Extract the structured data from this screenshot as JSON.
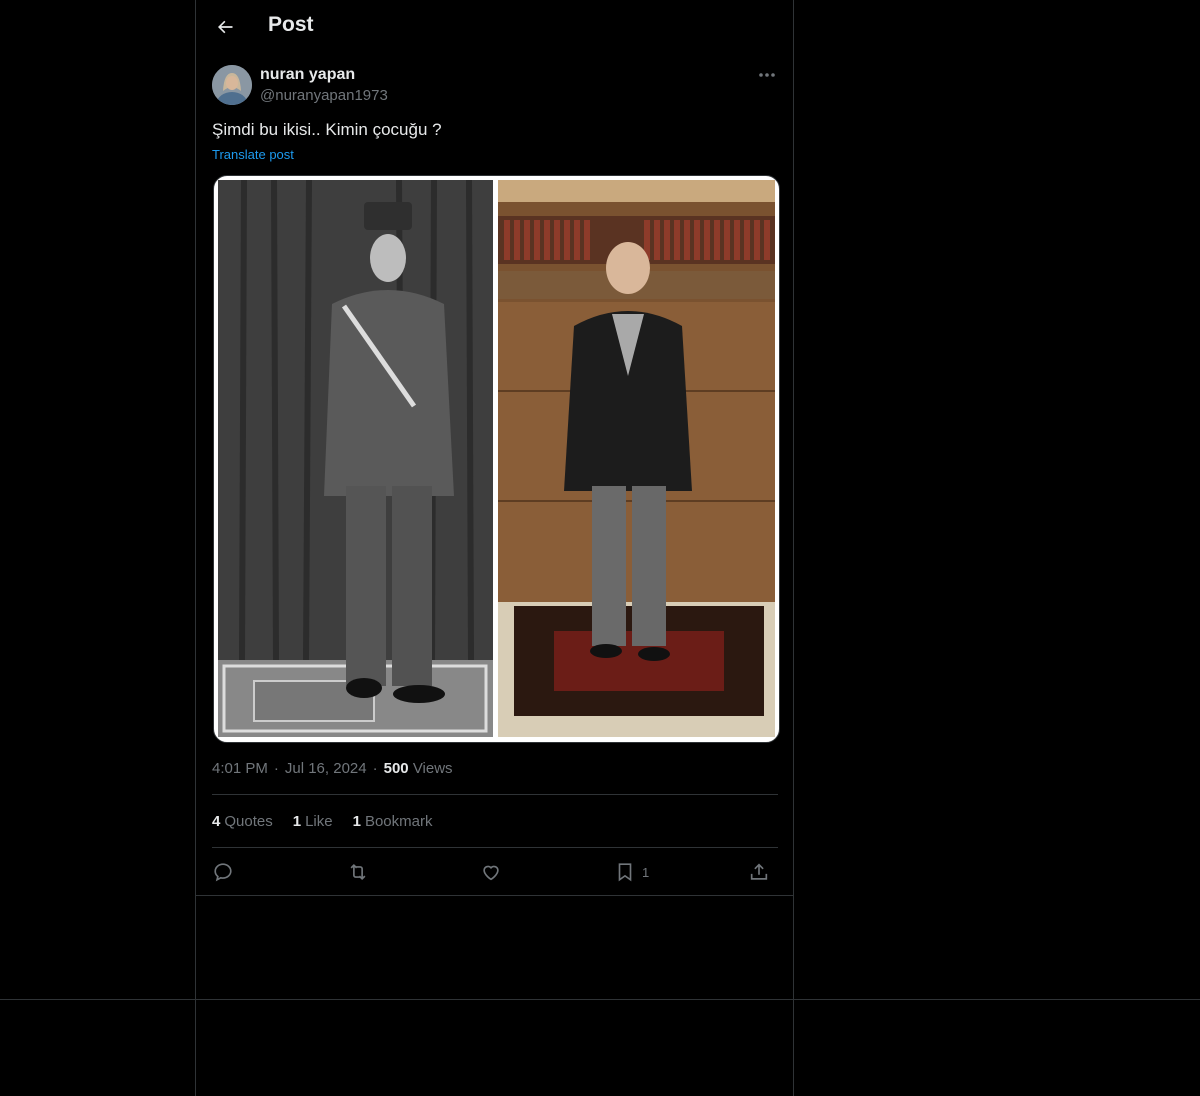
{
  "header": {
    "title": "Post"
  },
  "author": {
    "name": "nuran yapan",
    "handle": "@nuranyapan1973"
  },
  "post": {
    "text": "Şimdi bu ikisi.. Kimin çocuğu ?",
    "translate_label": "Translate post",
    "time": "4:01 PM",
    "date": "Jul 16, 2024",
    "views_count": "500",
    "views_label": "Views",
    "separator": "·"
  },
  "stats": {
    "quotes_count": "4",
    "quotes_label": "Quotes",
    "likes_count": "1",
    "likes_label": "Like",
    "bookmarks_count": "1",
    "bookmarks_label": "Bookmark"
  },
  "actions": {
    "bookmark_count": "1",
    "icons": [
      "reply-icon",
      "repost-icon",
      "like-icon",
      "bookmark-icon",
      "share-icon"
    ]
  },
  "colors": {
    "background": "#000000",
    "border": "#2f3336",
    "text": "#e7e9ea",
    "muted": "#71767b",
    "link": "#1d9bf0"
  }
}
